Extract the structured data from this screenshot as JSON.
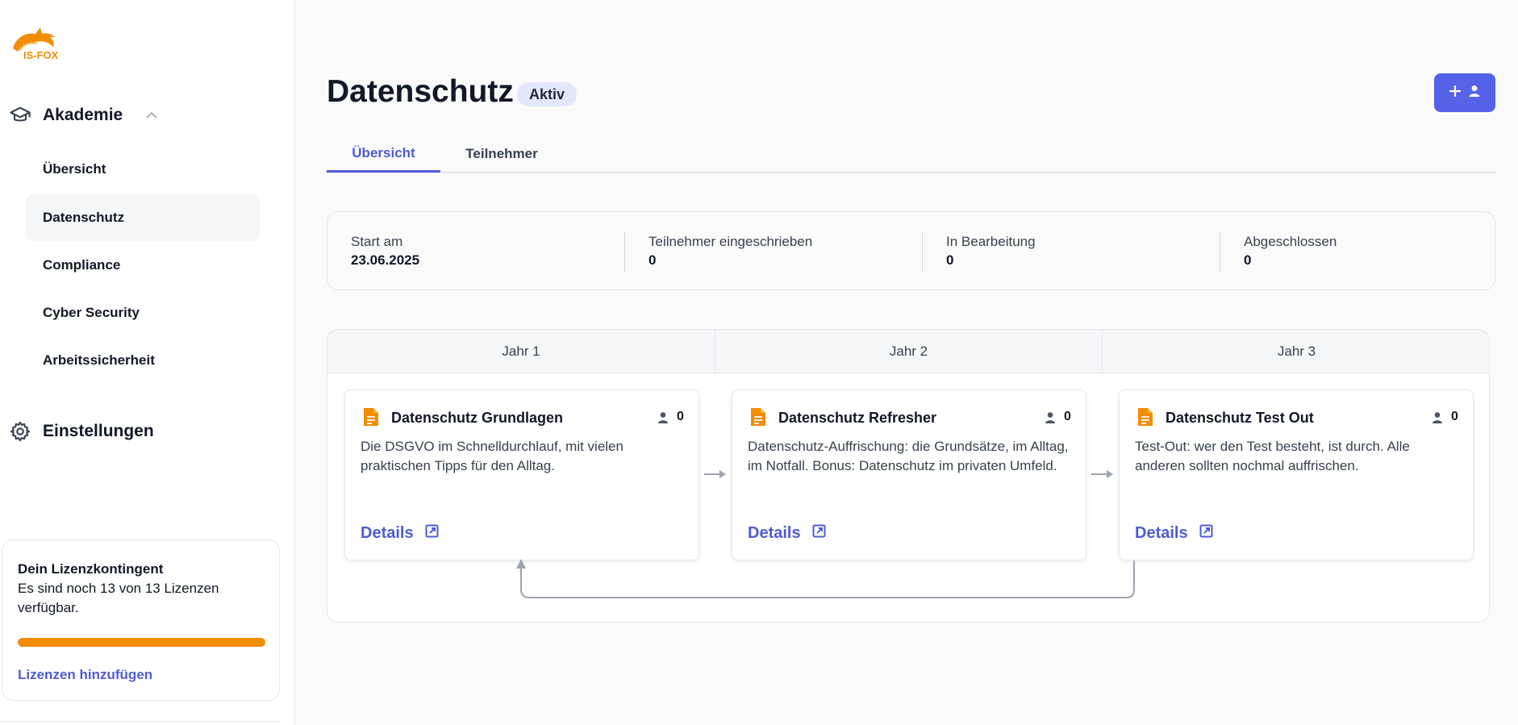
{
  "brand": {
    "logo_text": "IS-FOX",
    "accent": "#f28c00",
    "primary": "#5561e6"
  },
  "sidebar": {
    "academy_label": "Akademie",
    "items": [
      {
        "label": "Übersicht"
      },
      {
        "label": "Datenschutz"
      },
      {
        "label": "Compliance"
      },
      {
        "label": "Cyber Security"
      },
      {
        "label": "Arbeitssicherheit"
      }
    ],
    "settings_label": "Einstellungen",
    "license": {
      "title": "Dein Lizenzkontingent",
      "text": "Es sind noch 13 von 13 Lizenzen verfügbar.",
      "fill_fraction": 1.0,
      "link": "Lizenzen hinzufügen"
    }
  },
  "header": {
    "title": "Datenschutz",
    "status": "Aktiv",
    "add_button_icons": [
      "plus-icon",
      "user-icon"
    ]
  },
  "tabs": [
    {
      "label": "Übersicht"
    },
    {
      "label": "Teilnehmer"
    }
  ],
  "stats": [
    {
      "label": "Start am",
      "value": "23.06.2025"
    },
    {
      "label": "Teilnehmer eingeschrieben",
      "value": "0"
    },
    {
      "label": "In Bearbeitung",
      "value": "0"
    },
    {
      "label": "Abgeschlossen",
      "value": "0"
    }
  ],
  "timeline": {
    "years": [
      {
        "label": "Jahr 1"
      },
      {
        "label": "Jahr 2"
      },
      {
        "label": "Jahr 3"
      }
    ],
    "courses": [
      {
        "title": "Datenschutz Grundlagen",
        "count": "0",
        "description": "Die DSGVO im Schnelldurchlauf, mit vielen praktischen Tipps für den Alltag.",
        "details": "Details"
      },
      {
        "title": "Datenschutz Refresher",
        "count": "0",
        "description": "Datenschutz-Auffrischung: die Grundsätze, im Alltag, im Notfall. Bonus: Datenschutz im privaten Umfeld.",
        "details": "Details"
      },
      {
        "title": "Datenschutz Test Out",
        "count": "0",
        "description": "Test-Out: wer den Test besteht, ist durch. Alle anderen sollten nochmal auffrischen.",
        "details": "Details"
      }
    ]
  }
}
